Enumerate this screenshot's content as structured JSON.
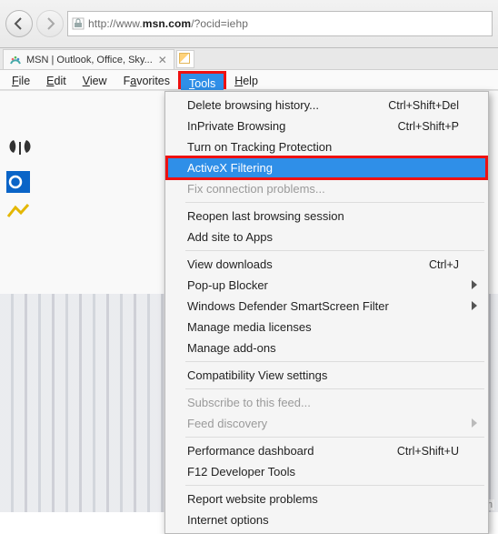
{
  "address": {
    "prefix": "http://www.",
    "host": "msn.com",
    "path": "/?ocid=iehp"
  },
  "tab": {
    "title": "MSN | Outlook, Office, Sky..."
  },
  "menubar": [
    "File",
    "Edit",
    "View",
    "Favorites",
    "Tools",
    "Help"
  ],
  "menu": {
    "delete_history": "Delete browsing history...",
    "delete_history_sc": "Ctrl+Shift+Del",
    "inprivate": "InPrivate Browsing",
    "inprivate_sc": "Ctrl+Shift+P",
    "tracking": "Turn on Tracking Protection",
    "activex": "ActiveX Filtering",
    "fixconn": "Fix connection problems...",
    "reopen": "Reopen last browsing session",
    "addapp": "Add site to Apps",
    "downloads": "View downloads",
    "downloads_sc": "Ctrl+J",
    "popup": "Pop-up Blocker",
    "smartscreen": "Windows Defender SmartScreen Filter",
    "media": "Manage media licenses",
    "addons": "Manage add-ons",
    "compat": "Compatibility View settings",
    "subfeed": "Subscribe to this feed...",
    "feeddisc": "Feed discovery",
    "perfdash": "Performance dashboard",
    "perfdash_sc": "Ctrl+Shift+U",
    "f12": "F12 Developer Tools",
    "report": "Report website problems",
    "inetopt": "Internet options"
  },
  "watermark": "wsxdn.com"
}
